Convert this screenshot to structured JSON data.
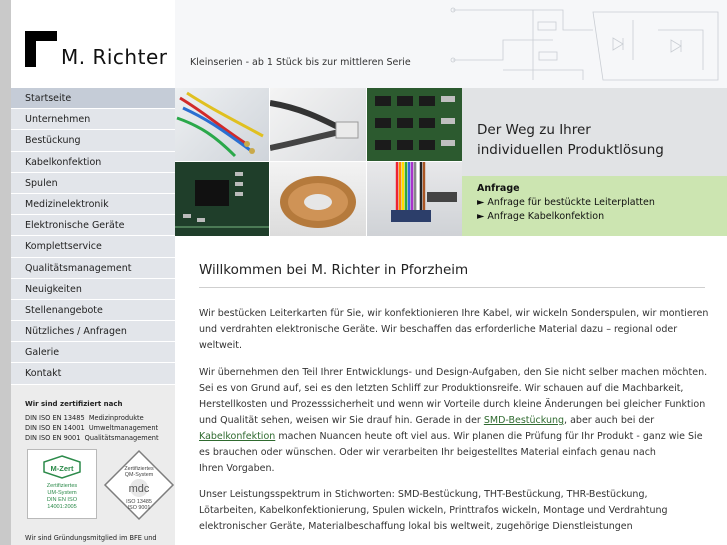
{
  "brand": {
    "name": "M. Richter"
  },
  "header": {
    "tagline": "Kleinserien - ab 1 Stück bis zur mittleren Serie"
  },
  "nav": {
    "items": [
      {
        "label": "Startseite",
        "active": true
      },
      {
        "label": "Unternehmen"
      },
      {
        "label": "Bestückung"
      },
      {
        "label": "Kabelkonfektion"
      },
      {
        "label": "Spulen"
      },
      {
        "label": "Medizinelektronik"
      },
      {
        "label": "Elektronische Geräte"
      },
      {
        "label": "Komplettservice"
      },
      {
        "label": "Qualitätsmanagement"
      },
      {
        "label": "Neuigkeiten"
      },
      {
        "label": "Stellenangebote"
      },
      {
        "label": "Nützliches / Anfragen"
      },
      {
        "label": "Galerie"
      },
      {
        "label": "Kontakt"
      }
    ]
  },
  "certification": {
    "title": "Wir sind zertifiziert nach",
    "lines": [
      {
        "std": "DIN ISO EN 13485",
        "desc": "Medizinprodukte"
      },
      {
        "std": "DIN ISO EN 14001",
        "desc": "Umweltmanagement"
      },
      {
        "std": "DIN ISO EN 9001",
        "desc": "Qualitätsmanagement"
      }
    ],
    "badge_mzert": {
      "brand": "M-Zert",
      "line1": "Zertifiziertes",
      "line2": "UM-System",
      "line3": "DIN EN ISO",
      "line4": "14001:2005"
    },
    "badge_mdc": {
      "line1": "Zertifiziertes",
      "line2": "QM-System",
      "brand": "mdc",
      "line3": "ISO 13485",
      "line4": "ISO 9001"
    },
    "footer_note": "Wir sind Gründungsmitglied im BFE und"
  },
  "promo": {
    "line1": "Der Weg zu Ihrer",
    "line2": "individuellen Produktlösung"
  },
  "inquiry": {
    "title": "Anfrage",
    "links": [
      "► Anfrage für bestückte Leiterplatten",
      "► Anfrage Kabelkonfektion"
    ]
  },
  "main": {
    "title": "Willkommen bei M. Richter in Pforzheim",
    "p1": [
      "Wir bestücken Leiterkarten für Sie, wir konfektionieren Ihre Kabel, wir wickeln Sonderspulen, wir montieren",
      "und verdrahten elektronische Geräte. Wir beschaffen das erforderliche Material dazu – regional oder",
      "weltweit."
    ],
    "p2": {
      "l1": "Wir übernehmen den Teil Ihrer Entwicklungs- und Design-Aufgaben, den Sie nicht selber machen möchten.",
      "l2": "Sei es von Grund auf, sei es den letzten Schliff zur Produktionsreife. Wir schauen auf die Machbarkeit,",
      "l3": "Herstellkosten und Prozesssicherheit und wenn wir Vorteile durch kleine Änderungen bei gleicher Funktion",
      "l4_pre": "und Qualität sehen, weisen wir Sie drauf hin. Gerade in der ",
      "l4_link": "SMD-Bestückung",
      "l4_post": ", aber auch bei der",
      "l5_link": "Kabelkonfektion",
      "l5_post": " machen Nuancen heute oft viel aus.  Wir planen die Prüfung für Ihr Produkt - ganz wie Sie",
      "l6": "es brauchen oder wünschen. Oder wir verarbeiten Ihr beigestelltes Material einfach genau nach",
      "l7": "Ihren Vorgaben."
    },
    "p3": [
      "Unser Leistungsspektrum in Stichworten: SMD-Bestückung, THT-Bestückung, THR-Bestückung,",
      "Lötarbeiten, Kabelkonfektionierung, Spulen wickeln, Printtrafos wickeln, Montage und Verdrahtung",
      "elektronischer Geräte, Materialbeschaffung lokal bis weltweit, zugehörige Dienstleistungen"
    ]
  },
  "colors": {
    "nav_bg": "#e2e5ea",
    "nav_active_bg": "#c5ccd7",
    "promo_bg": "#e1e3e5",
    "inquiry_bg": "#cce5b1",
    "link": "#2f6a2f"
  }
}
